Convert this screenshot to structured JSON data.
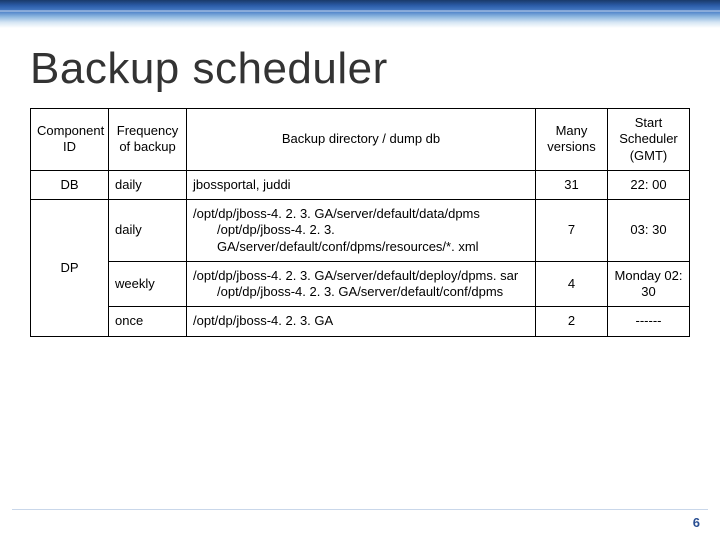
{
  "slide": {
    "title": "Backup scheduler",
    "page_number": "6"
  },
  "table": {
    "headers": {
      "component_id": "Component ID",
      "frequency": "Frequency of backup",
      "directory": "Backup directory / dump db",
      "many_versions": "Many versions",
      "start_scheduler": "Start Scheduler (GMT)"
    },
    "rows": [
      {
        "component_id": "DB",
        "frequency": "daily",
        "directory": "jbossportal, juddi",
        "many_versions": "31",
        "start_scheduler": "22: 00",
        "dir_align": "left",
        "hanging": false
      },
      {
        "component_id": "DP",
        "frequency": "daily",
        "directory": "/opt/dp/jboss-4. 2. 3. GA/server/default/data/dpms /opt/dp/jboss-4. 2. 3. GA/server/default/conf/dpms/resources/*. xml",
        "many_versions": "7",
        "start_scheduler": "03: 30",
        "dir_align": "left",
        "hanging": true
      },
      {
        "component_id": "",
        "frequency": "weekly",
        "directory": "/opt/dp/jboss-4. 2. 3. GA/server/default/deploy/dpms. sar /opt/dp/jboss-4. 2. 3. GA/server/default/conf/dpms",
        "many_versions": "4",
        "start_scheduler": "Monday 02: 30",
        "dir_align": "left",
        "hanging": true
      },
      {
        "component_id": "",
        "frequency": "once",
        "directory": "/opt/dp/jboss-4. 2. 3. GA",
        "many_versions": "2",
        "start_scheduler": "------",
        "dir_align": "left",
        "hanging": false
      }
    ]
  }
}
